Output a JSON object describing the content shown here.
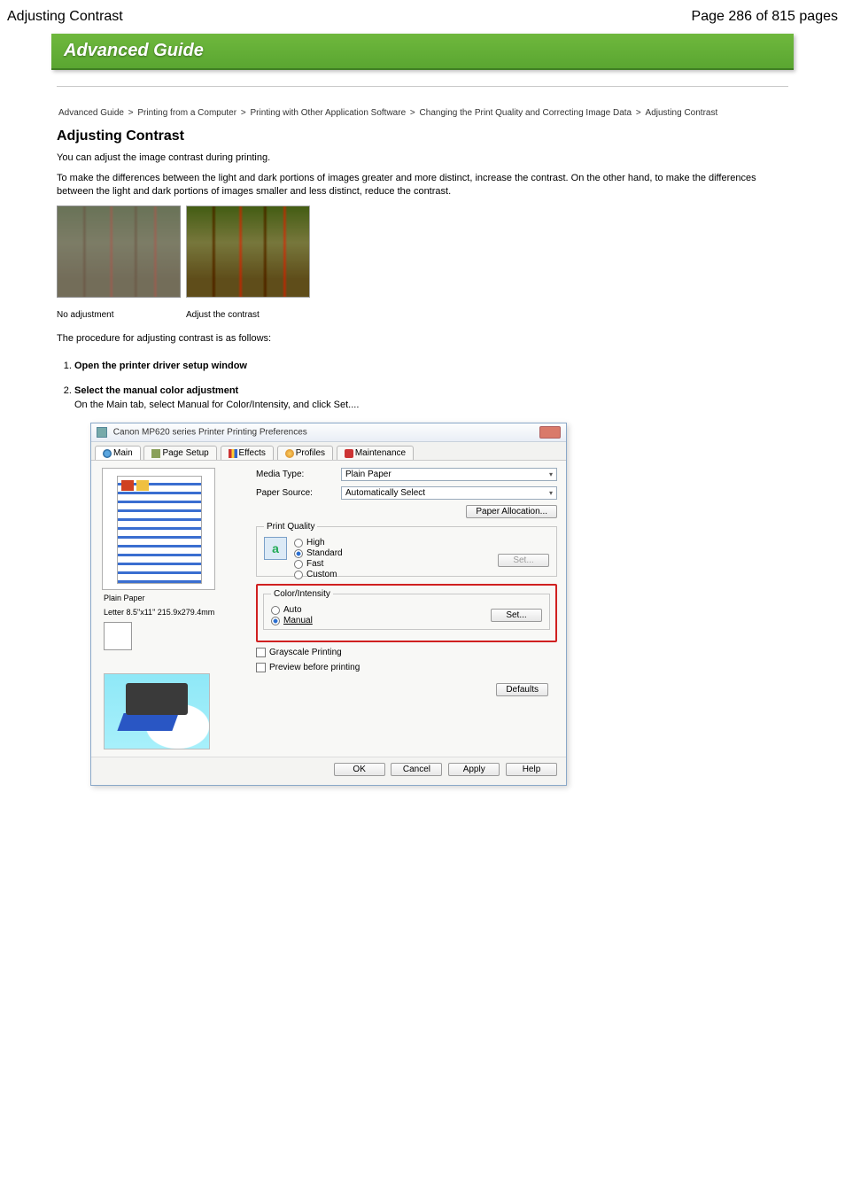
{
  "header": {
    "title_left": "Adjusting Contrast",
    "title_right": "Page 286 of 815 pages"
  },
  "banner": "Advanced Guide",
  "breadcrumb": [
    "Advanced Guide",
    "Printing from a Computer",
    "Printing with Other Application Software",
    "Changing the Print Quality and Correcting Image Data",
    "Adjusting Contrast"
  ],
  "sectionTitle": "Adjusting Contrast",
  "intro1": "You can adjust the image contrast during printing.",
  "intro2": "To make the differences between the light and dark portions of images greater and more distinct, increase the contrast. On the other hand, to make the differences between the light and dark portions of images smaller and less distinct, reduce the contrast.",
  "captions": {
    "none": "No adjustment",
    "adj": "Adjust the contrast"
  },
  "procIntro": "The procedure for adjusting contrast is as follows:",
  "steps": {
    "s1_title": "Open the printer driver setup window",
    "s2_title": "Select the manual color adjustment",
    "s2_body": "On the Main tab, select Manual for Color/Intensity, and click Set...."
  },
  "dialog": {
    "title": "Canon MP620 series Printer Printing Preferences",
    "tabs": {
      "main": "Main",
      "page": "Page Setup",
      "effects": "Effects",
      "profiles": "Profiles",
      "maintenance": "Maintenance"
    },
    "mediaType": {
      "label": "Media Type:",
      "value": "Plain Paper"
    },
    "paperSource": {
      "label": "Paper Source:",
      "value": "Automatically Select"
    },
    "paperAlloc": "Paper Allocation...",
    "previewLabel1": "Plain Paper",
    "previewLabel2": "Letter 8.5\"x11\" 215.9x279.4mm",
    "quality": {
      "legend": "Print Quality",
      "high": "High",
      "standard": "Standard",
      "fast": "Fast",
      "custom": "Custom",
      "set": "Set..."
    },
    "colorIntensity": {
      "legend": "Color/Intensity",
      "auto": "Auto",
      "manual": "Manual",
      "set": "Set..."
    },
    "grayscale": "Grayscale Printing",
    "previewChk": "Preview before printing",
    "defaults": "Defaults",
    "ok": "OK",
    "cancel": "Cancel",
    "apply": "Apply",
    "help": "Help"
  }
}
